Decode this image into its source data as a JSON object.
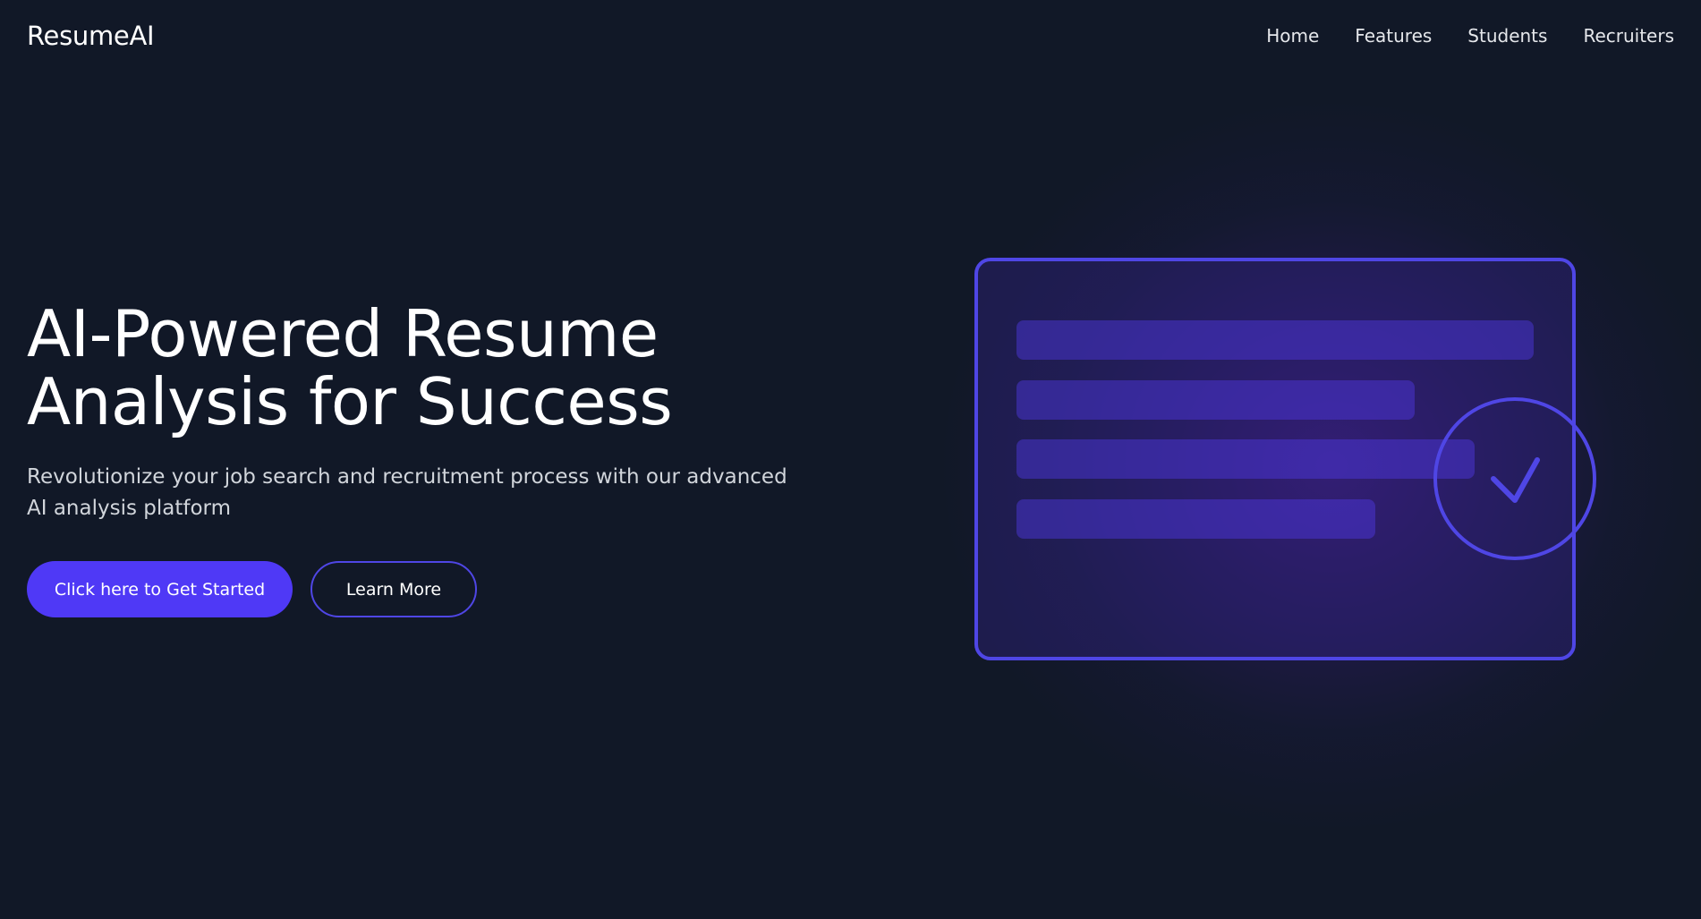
{
  "brand": {
    "logo_text": "ResumeAI"
  },
  "nav": {
    "links": [
      {
        "label": "Home"
      },
      {
        "label": "Features"
      },
      {
        "label": "Students"
      },
      {
        "label": "Recruiters"
      }
    ]
  },
  "hero": {
    "title_line1": "AI-Powered Resume",
    "title_line2": "Analysis for Success",
    "subtitle": "Revolutionize your job search and recruitment process with our advanced AI analysis platform",
    "primary_button": "Click here to Get Started",
    "secondary_button": "Learn More"
  },
  "illustration": {
    "icons": [
      "document-card-icon",
      "checkmark-circle-icon"
    ]
  },
  "colors": {
    "background": "#111827",
    "accent": "#4f39f6",
    "accent_border": "#4f46e5",
    "glow": "#4c1d95",
    "text_primary": "#ffffff",
    "text_secondary": "#d1d5db"
  }
}
